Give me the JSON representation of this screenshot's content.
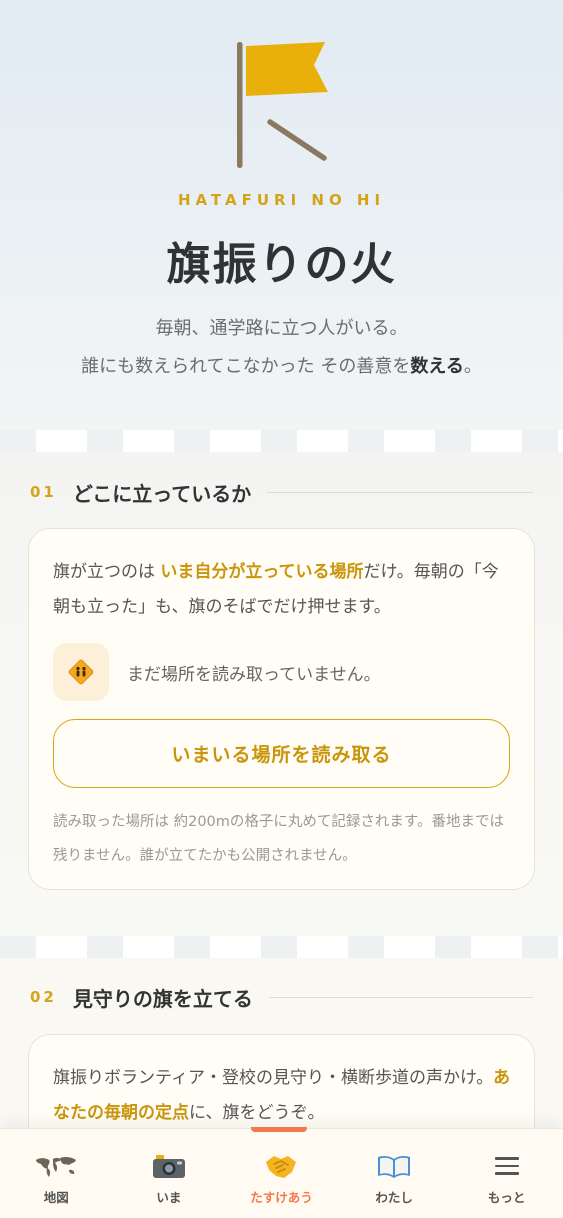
{
  "hero": {
    "kicker": "HATAFURI NO HI",
    "title": "旗振りの火",
    "subtitle_line1": "毎朝、通学路に立つ人がいる。",
    "subtitle_line2_pre": "誰にも数えられてこなかった その善意を",
    "subtitle_line2_strong": "数える",
    "subtitle_line2_post": "。"
  },
  "section1": {
    "number": "01",
    "title": "どこに立っているか",
    "text_pre": "旗が立つのは ",
    "text_highlight": "いま自分が立っている場所",
    "text_post": "だけ。毎朝の「今朝も立った」も、旗のそばでだけ押せます。",
    "location_status": "まだ場所を読み取っていません。",
    "read_button_label": "いまいる場所を読み取る",
    "note": "読み取った場所は 約200mの格子に丸めて記録されます。番地までは残りません。誰が立てたかも公開されません。"
  },
  "section2": {
    "number": "02",
    "title": "見守りの旗を立てる",
    "text_pre": "旗振りボランティア・登校の見守り・横断歩道の声かけ。",
    "text_highlight": "あなたの毎朝の定点",
    "text_post": "に、旗をどうぞ。"
  },
  "tabbar": {
    "tabs": [
      {
        "label": "地図",
        "icon": "world-map-icon"
      },
      {
        "label": "いま",
        "icon": "camera-icon"
      },
      {
        "label": "たすけあう",
        "icon": "handshake-icon",
        "active": true
      },
      {
        "label": "わたし",
        "icon": "book-icon"
      },
      {
        "label": "もっと",
        "icon": "menu-icon"
      }
    ]
  },
  "colors": {
    "accent_gold": "#d4a418",
    "active_tab": "#f07a4e",
    "flag": "#e9b00c",
    "pole": "#8a7860"
  }
}
